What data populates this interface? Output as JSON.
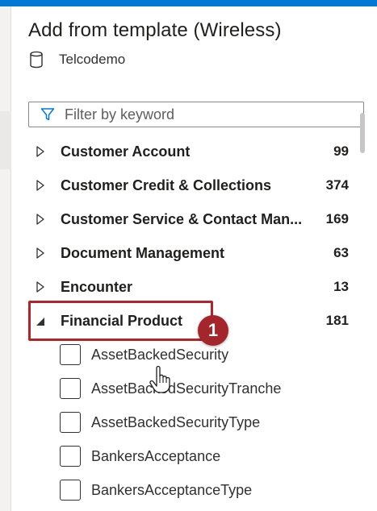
{
  "panel": {
    "title": "Add from template (Wireless)",
    "environment_icon": "database-icon",
    "environment_name": "Telcodemo"
  },
  "filter": {
    "icon": "filter-icon",
    "placeholder": "Filter by keyword",
    "value": ""
  },
  "categories": [
    {
      "label": "Customer Account",
      "count": "99",
      "expanded": false
    },
    {
      "label": "Customer Credit & Collections",
      "count": "374",
      "expanded": false
    },
    {
      "label": "Customer Service & Contact Man...",
      "count": "169",
      "expanded": false
    },
    {
      "label": "Document Management",
      "count": "63",
      "expanded": false
    },
    {
      "label": "Encounter",
      "count": "13",
      "expanded": false
    },
    {
      "label": "Financial Product",
      "count": "181",
      "expanded": true
    }
  ],
  "financial_product_items": [
    {
      "label": "AssetBackedSecurity",
      "checked": false
    },
    {
      "label": "AssetBackedSecurityTranche",
      "checked": false
    },
    {
      "label": "AssetBackedSecurityType",
      "checked": false
    },
    {
      "label": "BankersAcceptance",
      "checked": false
    },
    {
      "label": "BankersAcceptanceType",
      "checked": false
    }
  ],
  "annotation": {
    "step_number": "1",
    "color": "#a4262c"
  },
  "colors": {
    "accent": "#0078d4",
    "annotation_red": "#b0242a"
  }
}
